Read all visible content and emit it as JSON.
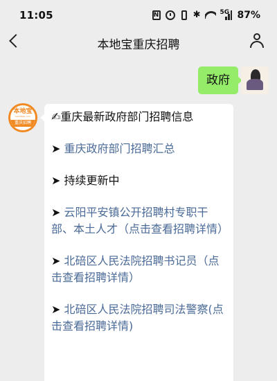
{
  "status_bar": {
    "time": "11:05",
    "nfc_label": "N",
    "bluetooth_glyph": "✱",
    "signal_label": "5G",
    "battery": "87%"
  },
  "header": {
    "title": "本地宝重庆招聘",
    "back_icon": "chevron-left-icon",
    "profile_icon": "person-icon"
  },
  "outgoing_message": {
    "text": "政府"
  },
  "bot_avatar": {
    "logo_text": "本地宝",
    "logo_url_text": "bendibao.com",
    "logo_band_text": "重庆招聘"
  },
  "incoming_message": {
    "heading_icon": "✍",
    "heading": "重庆最新政府部门招聘信息",
    "arrow": "➤",
    "items": [
      {
        "text": "重庆政府部门招聘汇总",
        "is_link": true
      },
      {
        "text": "持续更新中",
        "is_link": false
      },
      {
        "text": "云阳平安镇公开招聘村专职干部、本土人才（点击查看招聘详情）",
        "is_link": true
      },
      {
        "text": "北碚区人民法院招聘书记员（点击查看招聘详情）",
        "is_link": true
      },
      {
        "text": "北碚区人民法院招聘司法警察(点击查看招聘详情)",
        "is_link": true
      }
    ]
  },
  "colors": {
    "background": "#ededed",
    "outgoing_bubble": "#95ec69",
    "link": "#4a6a97",
    "logo_orange": "#f28a24"
  }
}
